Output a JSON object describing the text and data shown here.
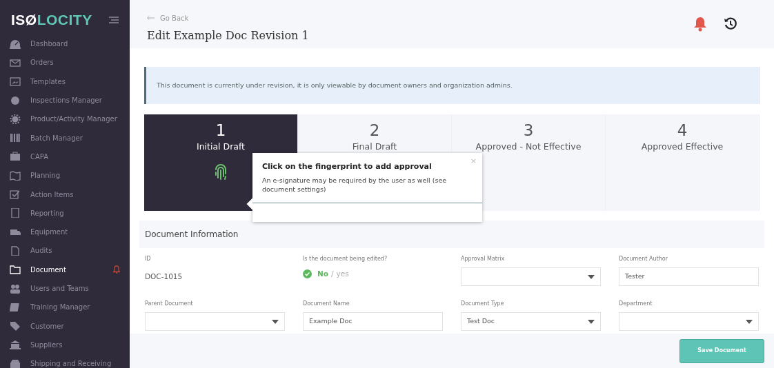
{
  "sidebar": {
    "logo": [
      "ISØ",
      "LOCITY"
    ],
    "items": [
      {
        "label": "Dashboard",
        "selected": false,
        "alert": false
      },
      {
        "label": "Orders",
        "selected": false,
        "alert": false
      },
      {
        "label": "Templates",
        "selected": false,
        "alert": false
      },
      {
        "label": "Inspections Manager",
        "selected": false,
        "alert": false
      },
      {
        "label": "Product/Activity Manager",
        "selected": false,
        "alert": false
      },
      {
        "label": "Batch Manager",
        "selected": false,
        "alert": false
      },
      {
        "label": "CAPA",
        "selected": false,
        "alert": false
      },
      {
        "label": "Planning",
        "selected": false,
        "alert": false
      },
      {
        "label": "Action Items",
        "selected": false,
        "alert": false
      },
      {
        "label": "Reporting",
        "selected": false,
        "alert": false
      },
      {
        "label": "Equipment",
        "selected": false,
        "alert": false
      },
      {
        "label": "Audits",
        "selected": false,
        "alert": false
      },
      {
        "label": "Document",
        "selected": true,
        "alert": true
      },
      {
        "label": "Users and Teams",
        "selected": false,
        "alert": false
      },
      {
        "label": "Training Manager",
        "selected": false,
        "alert": false
      },
      {
        "label": "Customer",
        "selected": false,
        "alert": false
      },
      {
        "label": "Suppliers",
        "selected": false,
        "alert": false
      },
      {
        "label": "Shipping and Receiving",
        "selected": false,
        "alert": false
      }
    ]
  },
  "header": {
    "back": "Go Back",
    "title": "Edit Example Doc Revision 1"
  },
  "notice": "This document is currently under revision, it is only viewable by document owners and organization admins.",
  "steps": [
    {
      "number": "1",
      "label": "Initial Draft",
      "selected": true,
      "fingerprint": true
    },
    {
      "number": "2",
      "label": "Final Draft",
      "selected": false,
      "fingerprint": false
    },
    {
      "number": "3",
      "label": "Approved - Not Effective",
      "selected": false,
      "fingerprint": false
    },
    {
      "number": "4",
      "label": "Approved Effective",
      "selected": false,
      "fingerprint": false
    }
  ],
  "popover": {
    "title": "Click on the fingerprint to add approval",
    "body": "An e-signature may be required by the user as well (see document settings)",
    "close": "×"
  },
  "section_title": "Document Information",
  "fields": [
    {
      "kind": "text",
      "label": "ID",
      "value": "DOC-1015"
    },
    {
      "kind": "toggle",
      "label": "Is the document being edited?",
      "separator": "/",
      "options": [
        {
          "label": "No",
          "selected": true
        },
        {
          "label": "yes",
          "selected": false
        }
      ]
    },
    {
      "kind": "select",
      "label": "Approval Matrix"
    },
    {
      "kind": "input",
      "label": "Document Author",
      "value": "Tester"
    },
    {
      "kind": "select",
      "label": "Parent Document"
    },
    {
      "kind": "input",
      "label": "Document Name",
      "value": "Example Doc"
    },
    {
      "kind": "select",
      "label": "Document Type",
      "value": "Test Doc"
    },
    {
      "kind": "select",
      "label": "Department"
    }
  ],
  "save_button": "Save Document"
}
